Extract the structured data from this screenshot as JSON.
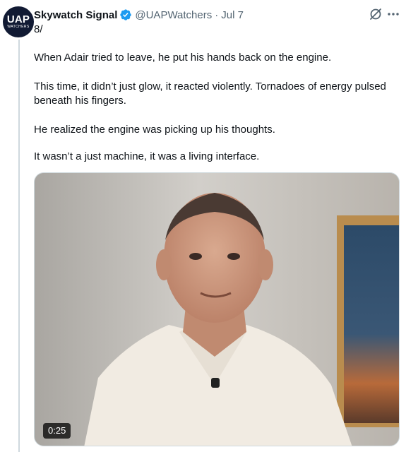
{
  "account": {
    "display_name": "Skywatch Signal",
    "handle": "@UAPWatchers",
    "date": "Jul 7",
    "avatar_text": "UAP",
    "avatar_subtext": "WATCHERS",
    "verified": true
  },
  "tweet": {
    "number": "8/",
    "paragraphs": [
      "When Adair tried to leave, he put his hands back on the engine.",
      "This time, it didn’t just glow, it reacted violently. Tornadoes of energy pulsed beneath his fingers.",
      "He realized the engine was picking up his thoughts.",
      "It wasn’t a just machine, it was a living interface."
    ]
  },
  "media": {
    "type": "video",
    "duration": "0:25"
  },
  "icons": {
    "grok": "grok-icon",
    "more": "more-icon",
    "verified": "verified-badge-icon"
  },
  "colors": {
    "text": "#0f1419",
    "secondary": "#536471",
    "verified_blue": "#1d9bf0",
    "avatar_bg": "#111a33"
  }
}
